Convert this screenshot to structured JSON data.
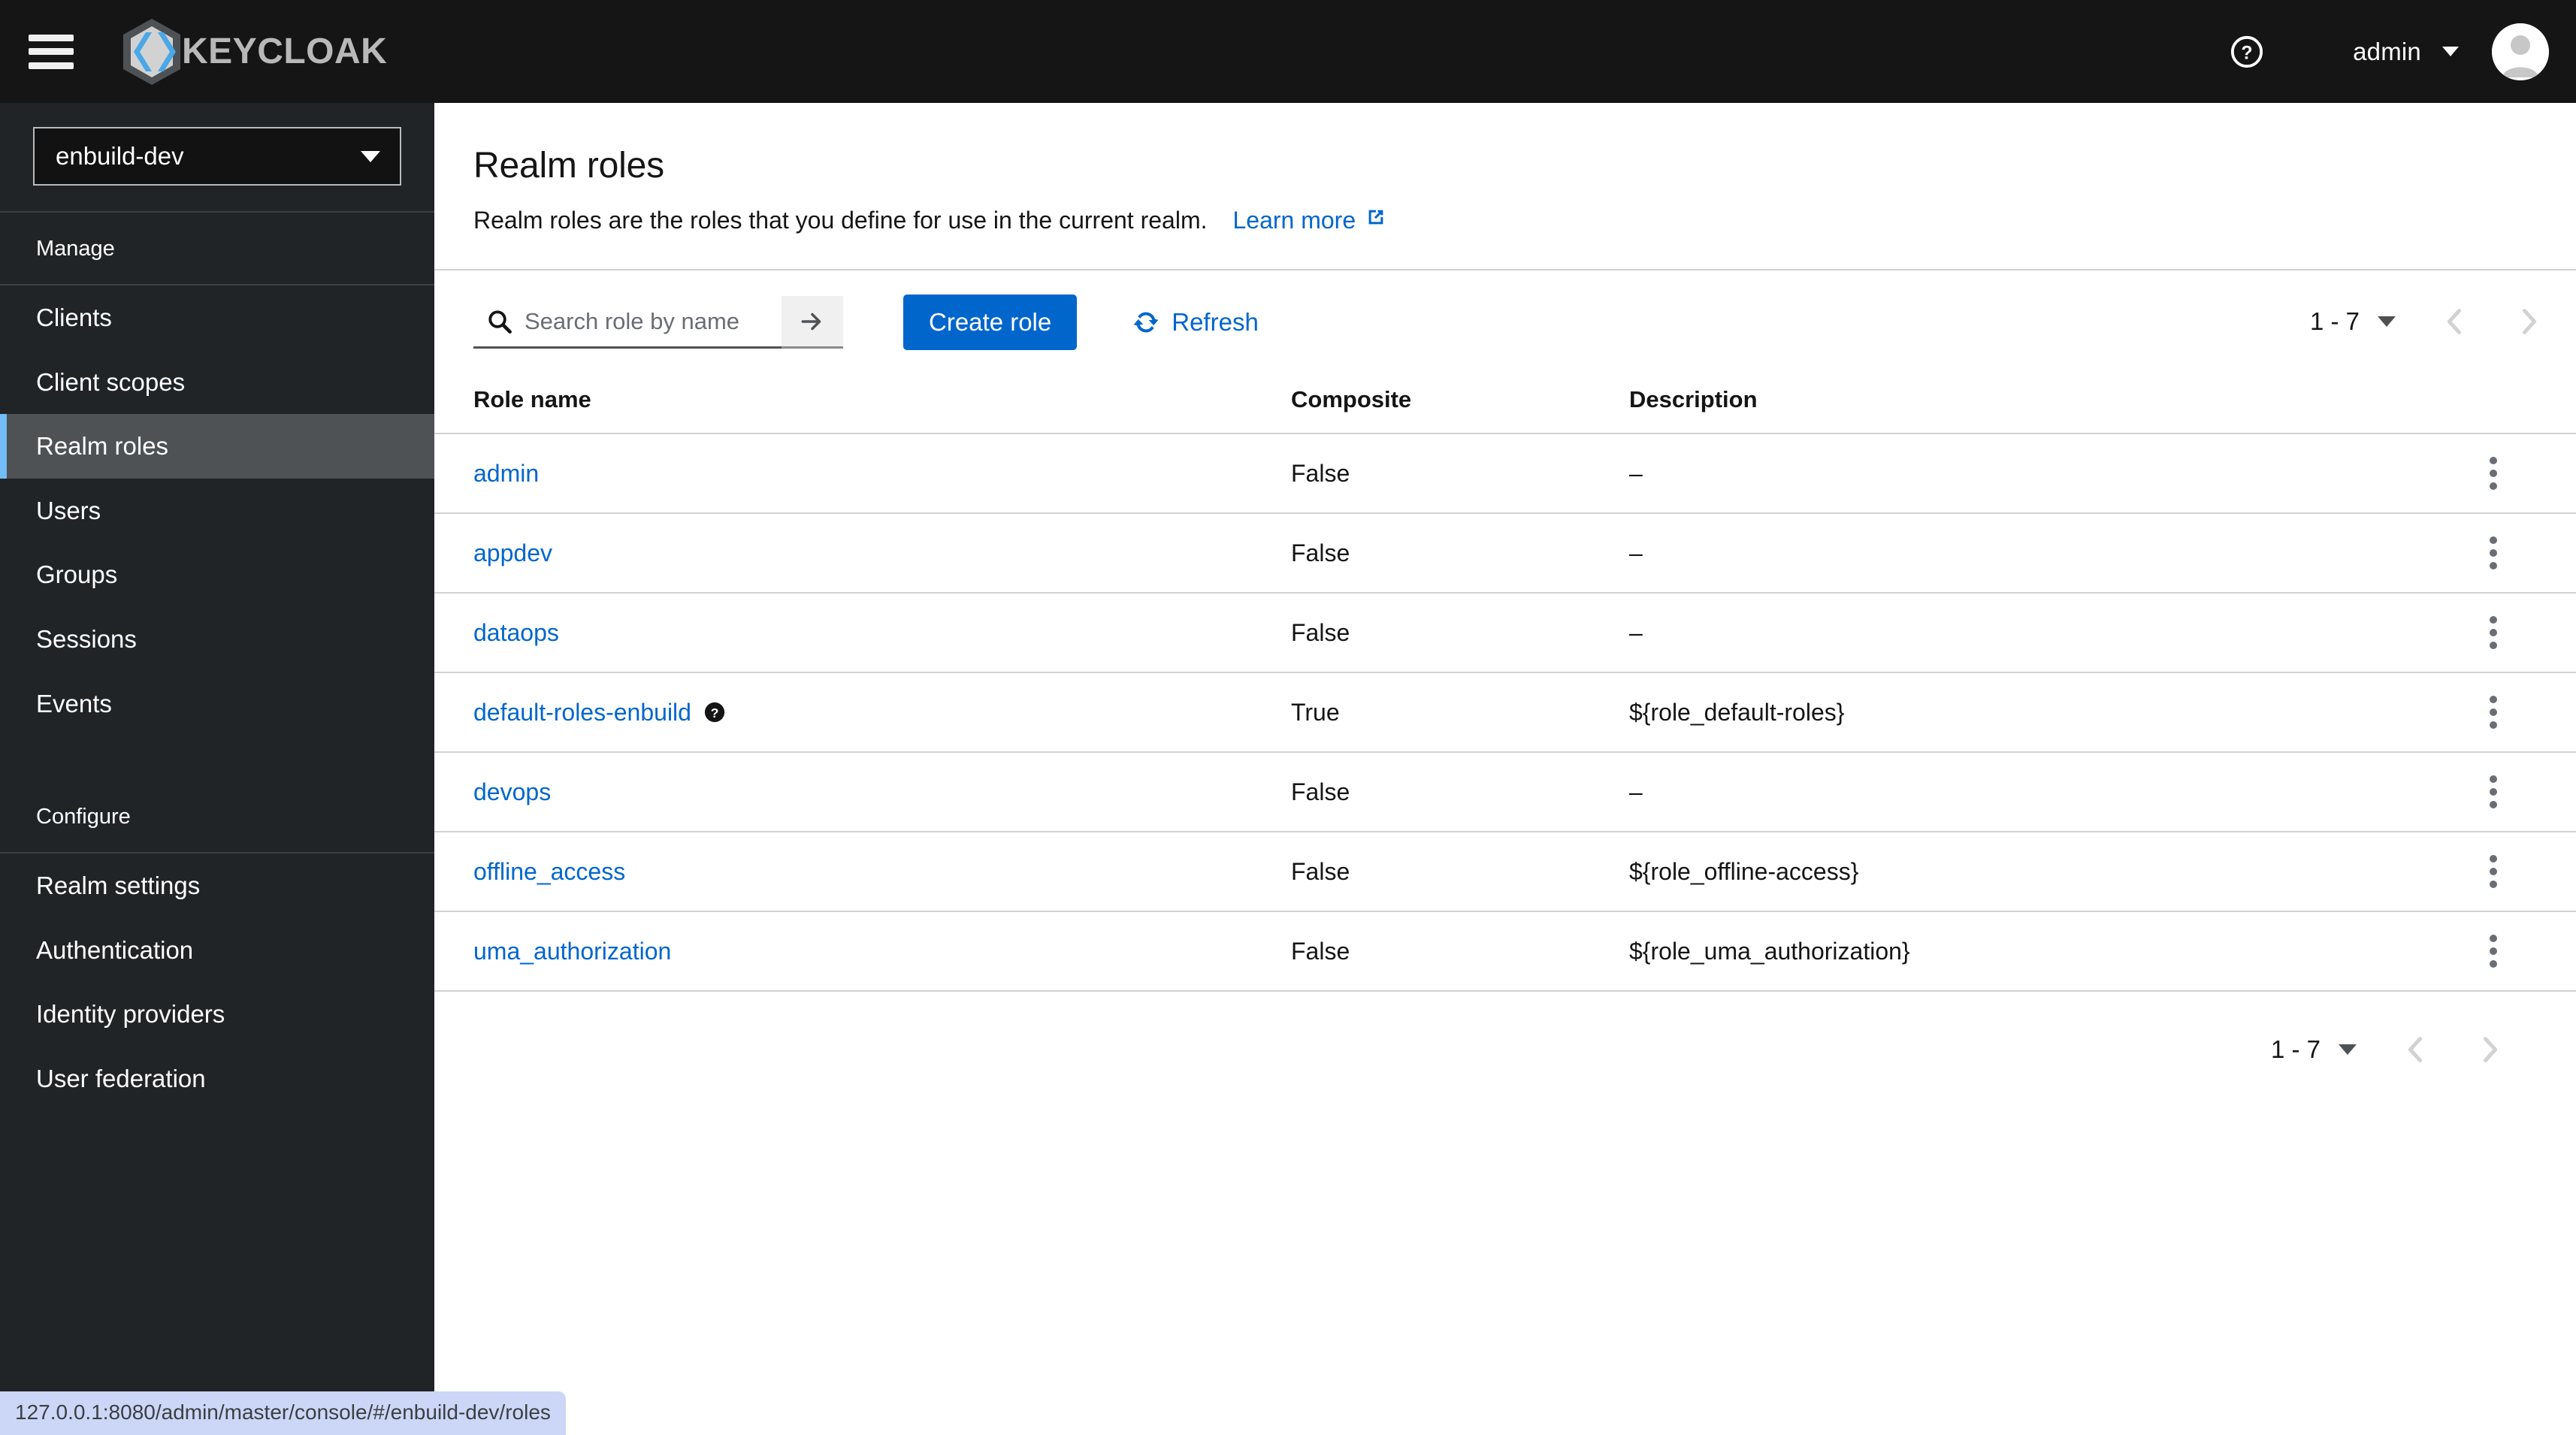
{
  "masthead": {
    "hamburger_label": "Global navigation",
    "brand_text": "KEYCLOAK",
    "help_label": "Help",
    "user_name": "admin"
  },
  "sidebar": {
    "realm_selector": {
      "value": "enbuild-dev"
    },
    "groups": [
      {
        "title": "Manage",
        "items": [
          {
            "label": "Clients",
            "active": false
          },
          {
            "label": "Client scopes",
            "active": false
          },
          {
            "label": "Realm roles",
            "active": true
          },
          {
            "label": "Users",
            "active": false
          },
          {
            "label": "Groups",
            "active": false
          },
          {
            "label": "Sessions",
            "active": false
          },
          {
            "label": "Events",
            "active": false
          }
        ]
      },
      {
        "title": "Configure",
        "items": [
          {
            "label": "Realm settings",
            "active": false
          },
          {
            "label": "Authentication",
            "active": false
          },
          {
            "label": "Identity providers",
            "active": false
          },
          {
            "label": "User federation",
            "active": false
          }
        ]
      }
    ]
  },
  "page": {
    "title": "Realm roles",
    "subtitle": "Realm roles are the roles that you define for use in the current realm.",
    "learn_more": "Learn more"
  },
  "toolbar": {
    "search_placeholder": "Search role by name",
    "search_value": "",
    "create_label": "Create role",
    "refresh_label": "Refresh"
  },
  "pagination": {
    "range": "1 - 7"
  },
  "table": {
    "columns": [
      "Role name",
      "Composite",
      "Description"
    ],
    "rows": [
      {
        "name": "admin",
        "has_help": false,
        "composite": "False",
        "description": "–"
      },
      {
        "name": "appdev",
        "has_help": false,
        "composite": "False",
        "description": "–"
      },
      {
        "name": "dataops",
        "has_help": false,
        "composite": "False",
        "description": "–"
      },
      {
        "name": "default-roles-enbuild",
        "has_help": true,
        "composite": "True",
        "description": "${role_default-roles}"
      },
      {
        "name": "devops",
        "has_help": false,
        "composite": "False",
        "description": "–"
      },
      {
        "name": "offline_access",
        "has_help": false,
        "composite": "False",
        "description": "${role_offline-access}"
      },
      {
        "name": "uma_authorization",
        "has_help": false,
        "composite": "False",
        "description": "${role_uma_authorization}"
      }
    ]
  },
  "status_bar": {
    "url": "127.0.0.1:8080/admin/master/console/#/enbuild-dev/roles"
  },
  "colors": {
    "masthead_bg": "#151515",
    "sidebar_bg": "#212427",
    "active_nav_bg": "#4f5255",
    "active_nav_accent": "#73bcf7",
    "link_blue": "#0066cc",
    "primary_button": "#0066cc",
    "status_url_bg": "#ccd7f7"
  }
}
